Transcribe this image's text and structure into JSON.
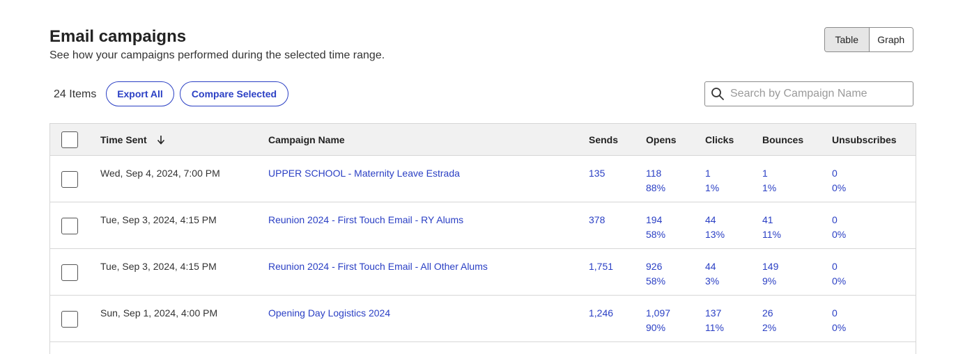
{
  "header": {
    "title": "Email campaigns",
    "subtitle": "See how your campaigns performed during the selected time range."
  },
  "view_toggle": {
    "table_label": "Table",
    "graph_label": "Graph",
    "selected": "Table"
  },
  "toolbar": {
    "items_count": "24 Items",
    "export_label": "Export All",
    "compare_label": "Compare Selected"
  },
  "search": {
    "placeholder": "Search by Campaign Name",
    "value": ""
  },
  "table": {
    "columns": {
      "time_sent": "Time Sent",
      "campaign_name": "Campaign Name",
      "sends": "Sends",
      "opens": "Opens",
      "clicks": "Clicks",
      "bounces": "Bounces",
      "unsubscribes": "Unsubscribes"
    },
    "rows": [
      {
        "time_sent": "Wed, Sep 4, 2024, 7:00 PM",
        "campaign_name": "UPPER SCHOOL - Maternity Leave Estrada",
        "sends": "135",
        "opens": "118",
        "opens_pct": "88%",
        "clicks": "1",
        "clicks_pct": "1%",
        "bounces": "1",
        "bounces_pct": "1%",
        "unsubscribes": "0",
        "unsubscribes_pct": "0%"
      },
      {
        "time_sent": "Tue, Sep 3, 2024, 4:15 PM",
        "campaign_name": "Reunion 2024 - First Touch Email - RY Alums",
        "sends": "378",
        "opens": "194",
        "opens_pct": "58%",
        "clicks": "44",
        "clicks_pct": "13%",
        "bounces": "41",
        "bounces_pct": "11%",
        "unsubscribes": "0",
        "unsubscribes_pct": "0%"
      },
      {
        "time_sent": "Tue, Sep 3, 2024, 4:15 PM",
        "campaign_name": "Reunion 2024 - First Touch Email - All Other Alums",
        "sends": "1,751",
        "opens": "926",
        "opens_pct": "58%",
        "clicks": "44",
        "clicks_pct": "3%",
        "bounces": "149",
        "bounces_pct": "9%",
        "unsubscribes": "0",
        "unsubscribes_pct": "0%"
      },
      {
        "time_sent": "Sun, Sep 1, 2024, 4:00 PM",
        "campaign_name": "Opening Day Logistics 2024",
        "sends": "1,246",
        "opens": "1,097",
        "opens_pct": "90%",
        "clicks": "137",
        "clicks_pct": "11%",
        "bounces": "26",
        "bounces_pct": "2%",
        "unsubscribes": "0",
        "unsubscribes_pct": "0%"
      }
    ]
  },
  "colors": {
    "link": "#2a3fc4",
    "header_bg": "#f1f1f1",
    "border": "#d6d6d6"
  },
  "icons": {
    "search": "search-icon",
    "sort": "arrow-down-icon"
  }
}
